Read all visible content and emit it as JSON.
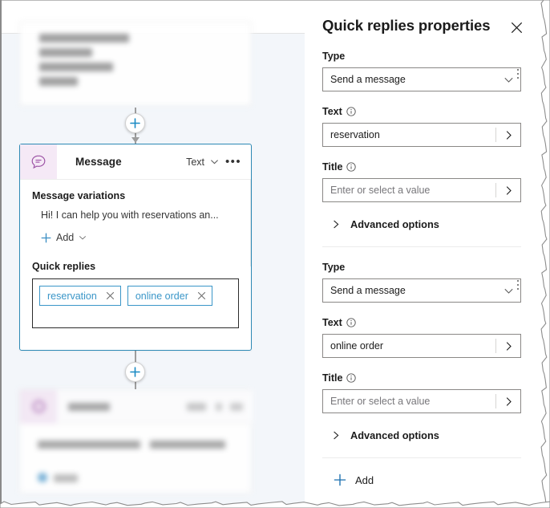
{
  "panel": {
    "title": "Quick replies properties",
    "close_icon": "close-icon",
    "kebab_icon": "more-options-icon",
    "groups": [
      {
        "type_label": "Type",
        "type_value": "Send a message",
        "text_label": "Text",
        "text_value": "reservation",
        "title_label": "Title",
        "title_placeholder": "Enter or select a value",
        "advanced_label": "Advanced options"
      },
      {
        "type_label": "Type",
        "type_value": "Send a message",
        "text_label": "Text",
        "text_value": "online order",
        "title_label": "Title",
        "title_placeholder": "Enter or select a value",
        "advanced_label": "Advanced options"
      }
    ],
    "add_label": "Add",
    "add_icon": "plus-icon"
  },
  "canvas": {
    "node": {
      "icon": "message-bubble-icon",
      "title": "Message",
      "header_type": "Text",
      "header_chevron_icon": "chevron-down-icon",
      "header_more_icon": "more-options-icon",
      "variations_label": "Message variations",
      "variation_text": "Hi! I can help you with reservations an...",
      "add_label": "Add",
      "add_icon": "plus-icon",
      "add_chevron_icon": "chevron-down-icon",
      "quick_replies_label": "Quick replies",
      "quick_replies": [
        {
          "label": "reservation",
          "remove_icon": "close-icon"
        },
        {
          "label": "online order",
          "remove_icon": "close-icon"
        }
      ]
    },
    "connector_add_icon": "plus-icon"
  },
  "colors": {
    "accent_blue": "#2d8ab5",
    "chip_blue": "#3a96c8",
    "node_icon_purple": "#9a4fa3",
    "canvas_bg": "#f3f6fa"
  }
}
